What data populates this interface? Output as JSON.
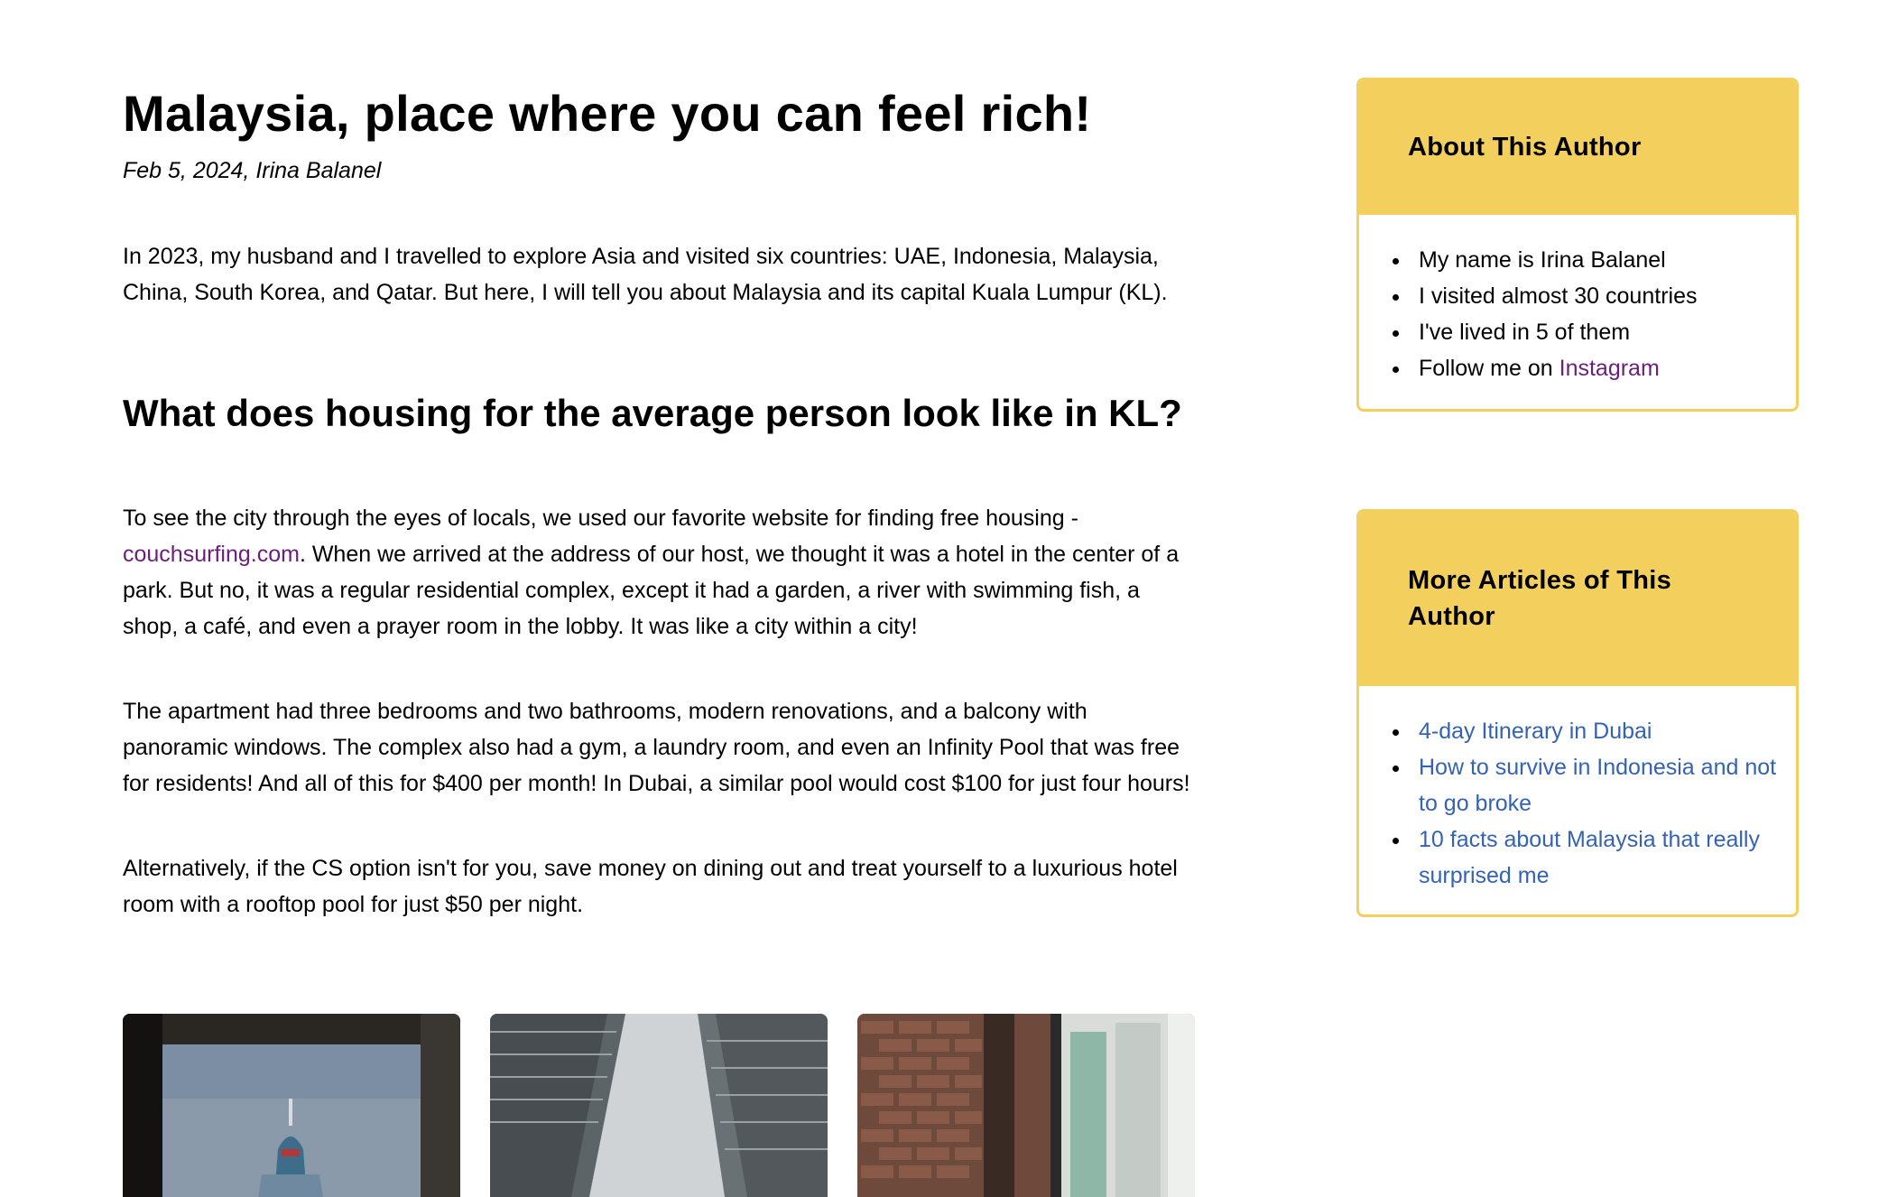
{
  "article": {
    "title": "Malaysia, place where you can feel rich!",
    "byline": "Feb 5, 2024, Irina Balanel",
    "intro": "In 2023, my husband and I travelled to explore Asia and visited six countries: UAE, Indonesia, Malaysia, China, South Korea, and Qatar. But here, I will tell you about Malaysia and its capital Kuala Lumpur (KL).",
    "section_heading": "What does housing for the average person look like in KL?",
    "p2_before": "To see the city through the eyes of locals, we used our favorite website for finding free housing - ",
    "p2_link": "couchsurfing.com",
    "p2_after": ". When we arrived at the address of our host, we thought it was a hotel in the center of a park. But no, it was a regular residential complex, except it had a garden, a river with swimming fish, a shop, a café, and even a prayer room in the lobby. It was like a city within a city!",
    "p3": "The apartment had three bedrooms and two bathrooms, modern renovations, and a balcony with panoramic windows. The complex also had a gym, a laundry room, and even an Infinity Pool that was free for residents! And all of this for $400 per month! In Dubai, a similar pool would cost $100 for just four hours!",
    "p4": "Alternatively, if the CS option isn't for you, save money on dining out and treat yourself to a luxurious hotel room with a rooftop pool for just $50 per night."
  },
  "sidebar": {
    "about": {
      "heading": "About This Author",
      "items": [
        "My name is Irina Balanel",
        "I visited almost 30 countries",
        "I've lived in 5 of them"
      ],
      "follow_prefix": "Follow me on ",
      "follow_link": "Instagram"
    },
    "more": {
      "heading": "More Articles of This Author",
      "links": [
        "4-day Itinerary in Dubai",
        "How to survive in Indonesia and not to go broke",
        "10 facts about Malaysia that really surprised me"
      ]
    }
  },
  "colors": {
    "accent_yellow": "#f3cf5d",
    "link_purple": "#6b1f7a",
    "link_blue": "#3462b4"
  }
}
